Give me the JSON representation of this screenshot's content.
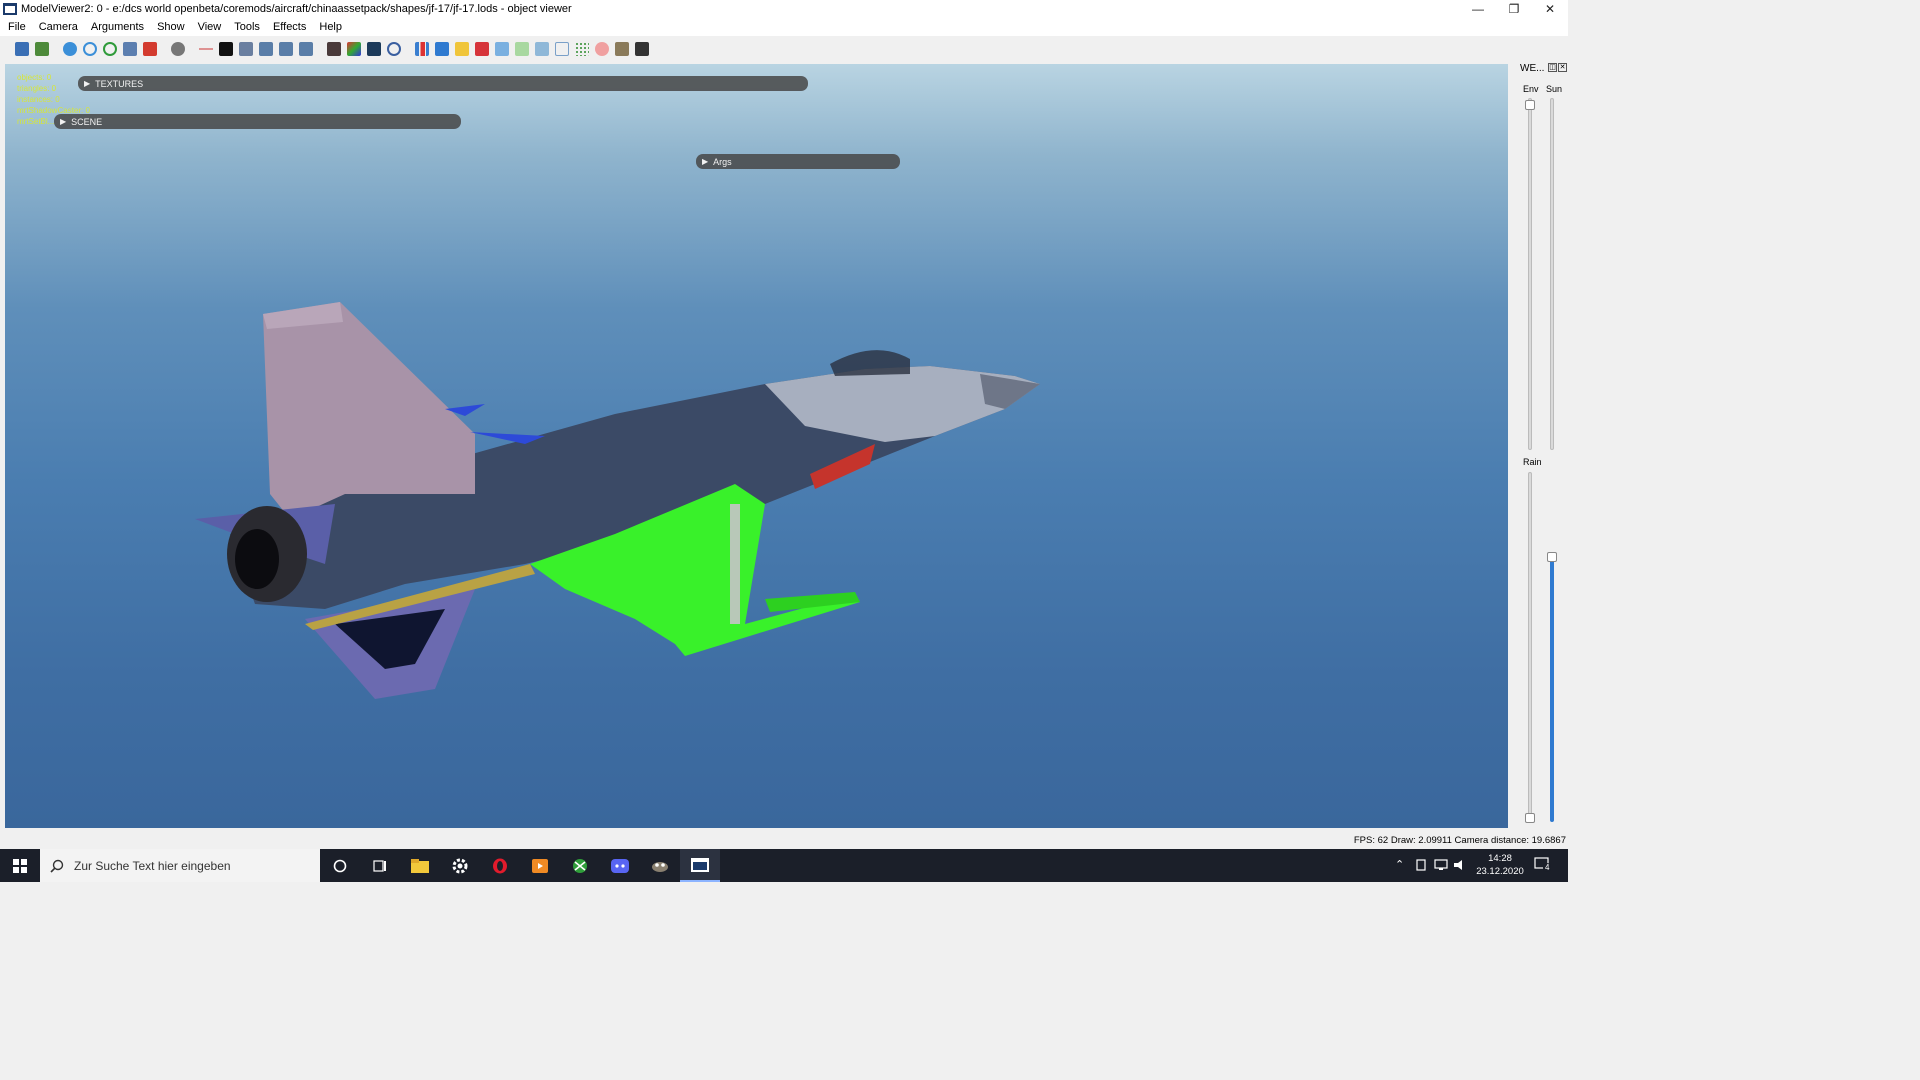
{
  "window": {
    "title": "ModelViewer2: 0 - e:/dcs world openbeta/coremods/aircraft/chinaassetpack/shapes/jf-17/jf-17.lods - object viewer",
    "min_glyph": "—",
    "max_glyph": "❐",
    "close_glyph": "✕"
  },
  "menu": [
    "File",
    "Camera",
    "Arguments",
    "Show",
    "View",
    "Tools",
    "Effects",
    "Help"
  ],
  "viewport": {
    "stats": [
      "objects: 0",
      "triangles: 0",
      "instances: 0",
      "mrtShadowCaster: 0",
      "mrtSetBl..."
    ],
    "panels": {
      "textures": "TEXTURES",
      "scene": "SCENE",
      "args": "Args"
    },
    "tri_glyph": "▶"
  },
  "weather": {
    "title": "WE...",
    "dock_glyph": "◫",
    "close_glyph": "✕",
    "env_label": "Env",
    "sun_label": "Sun",
    "rain_label": "Rain",
    "sun_level": 0.0,
    "rain_level": 0.76
  },
  "status": {
    "text": "FPS: 62  Draw: 2.09911  Camera distance: 19.6867"
  },
  "taskbar": {
    "search_placeholder": "Zur Suche Text hier eingeben",
    "time": "14:28",
    "date": "23.12.2020",
    "notification_count": "4"
  },
  "colors": {
    "accent": "#2f7ad0",
    "taskbar_bg": "#1b1f29",
    "stats_text": "#d6e63a",
    "selection_green": "#39f12a"
  }
}
